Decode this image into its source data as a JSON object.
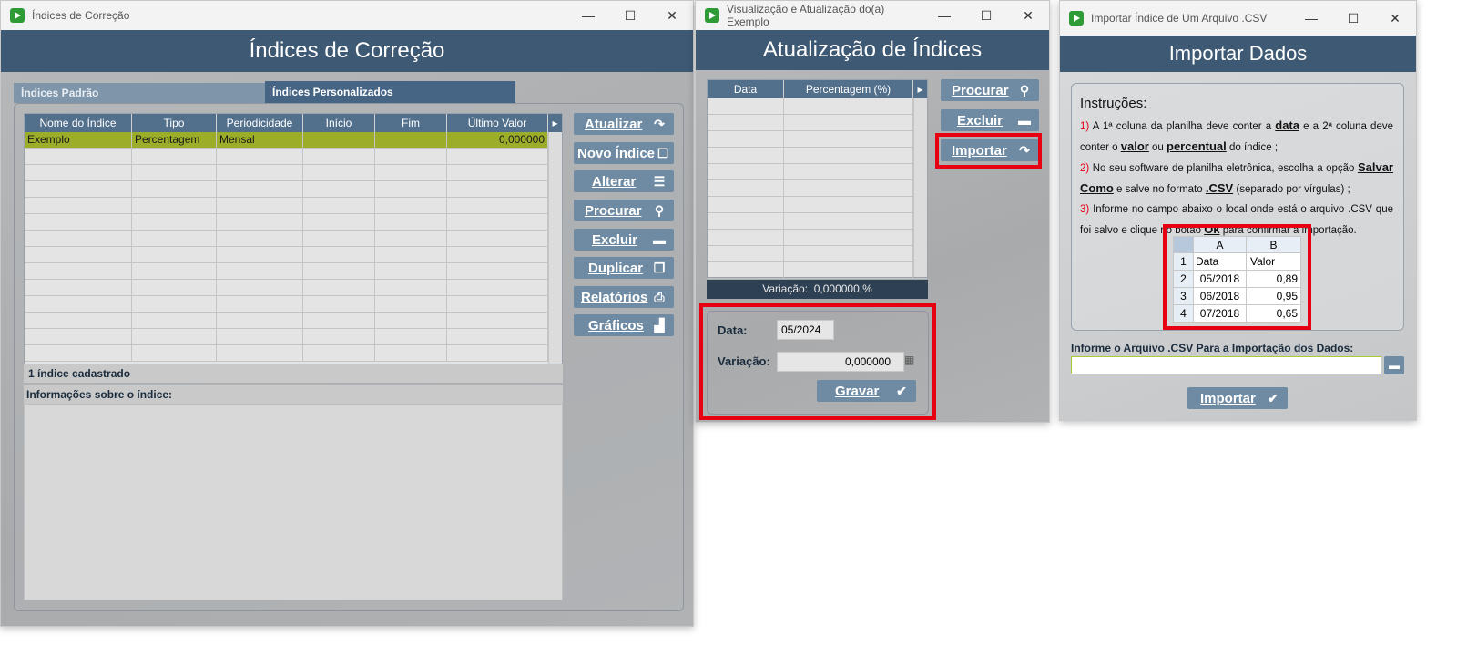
{
  "win1": {
    "title": "Índices de Correção",
    "header": "Índices de Correção",
    "tabs": {
      "padrao": "Índices Padrão",
      "personalizados": "Índices Personalizados"
    },
    "columns": [
      "Nome do Índice",
      "Tipo",
      "Periodicidade",
      "Início",
      "Fim",
      "Último Valor"
    ],
    "rows": [
      {
        "nome": "Exemplo",
        "tipo": "Percentagem",
        "periodicidade": "Mensal",
        "inicio": "",
        "fim": "",
        "valor": "0,000000"
      }
    ],
    "status": "1 índice cadastrado",
    "info_label": "Informações sobre o índice:",
    "buttons": {
      "atualizar": "Atualizar",
      "novo": "Novo Índice",
      "alterar": "Alterar",
      "procurar": "Procurar",
      "excluir": "Excluir",
      "duplicar": "Duplicar",
      "relatorios": "Relatórios",
      "graficos": "Gráficos"
    }
  },
  "win2": {
    "title": "Visualização e Atualização do(a) Exemplo",
    "header": "Atualização de Índices",
    "columns": [
      "Data",
      "Percentagem (%)"
    ],
    "variacao_bar": "Variação:  0,000000 %",
    "buttons": {
      "procurar": "Procurar",
      "excluir": "Excluir",
      "importar": "Importar",
      "gravar": "Gravar"
    },
    "form": {
      "data_label": "Data:",
      "data_value": "05/2024",
      "variacao_label": "Variação:",
      "variacao_value": "0,000000"
    }
  },
  "win3": {
    "title": "Importar Índice de Um Arquivo .CSV",
    "header": "Importar Dados",
    "instr_title": "Instruções:",
    "sheet": {
      "cols": [
        "A",
        "B"
      ],
      "rows": [
        [
          "1",
          "Data",
          "Valor"
        ],
        [
          "2",
          "05/2018",
          "0,89"
        ],
        [
          "3",
          "06/2018",
          "0,95"
        ],
        [
          "4",
          "07/2018",
          "0,65"
        ]
      ]
    },
    "file_label": "Informe o Arquivo .CSV Para a Importação dos Dados:",
    "file_value": "",
    "import_button": "Importar"
  }
}
